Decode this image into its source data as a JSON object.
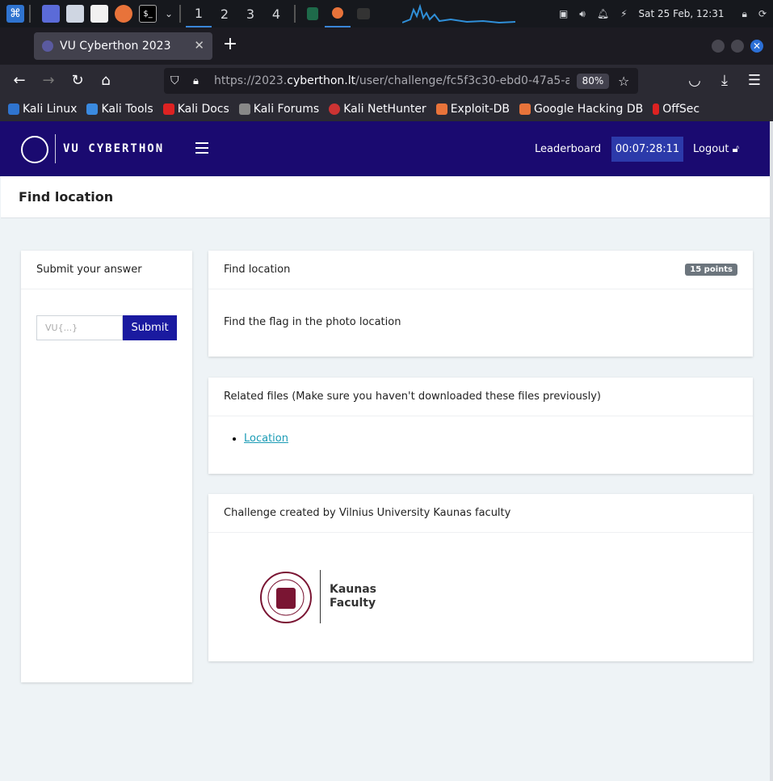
{
  "taskbar": {
    "workspaces": [
      "1",
      "2",
      "3",
      "4"
    ],
    "datetime": "Sat 25 Feb, 12:31"
  },
  "browser": {
    "tab_title": "VU Cyberthon 2023",
    "url_prefix": "https://2023.",
    "url_domain": "cyberthon.lt",
    "url_path": "/user/challenge/fc5f3c30-ebd0-47a5-a",
    "zoom": "80%",
    "bookmarks": [
      "Kali Linux",
      "Kali Tools",
      "Kali Docs",
      "Kali Forums",
      "Kali NetHunter",
      "Exploit-DB",
      "Google Hacking DB",
      "OffSec"
    ]
  },
  "site": {
    "brand": "VU CYBERTHON",
    "leaderboard": "Leaderboard",
    "timer": "00:07:28:11",
    "logout": "Logout"
  },
  "page": {
    "title": "Find location"
  },
  "answer_card": {
    "header": "Submit your answer",
    "placeholder": "VU{...}",
    "submit": "Submit"
  },
  "challenge_card": {
    "title": "Find location",
    "points": "15 points",
    "description": "Find the flag in the photo location"
  },
  "files_card": {
    "header": "Related files (Make sure you haven't downloaded these files previously)",
    "files": [
      "Location"
    ]
  },
  "creator_card": {
    "header": "Challenge created by Vilnius University Kaunas faculty",
    "logo_line1": "Kaunas",
    "logo_line2": "Faculty"
  }
}
